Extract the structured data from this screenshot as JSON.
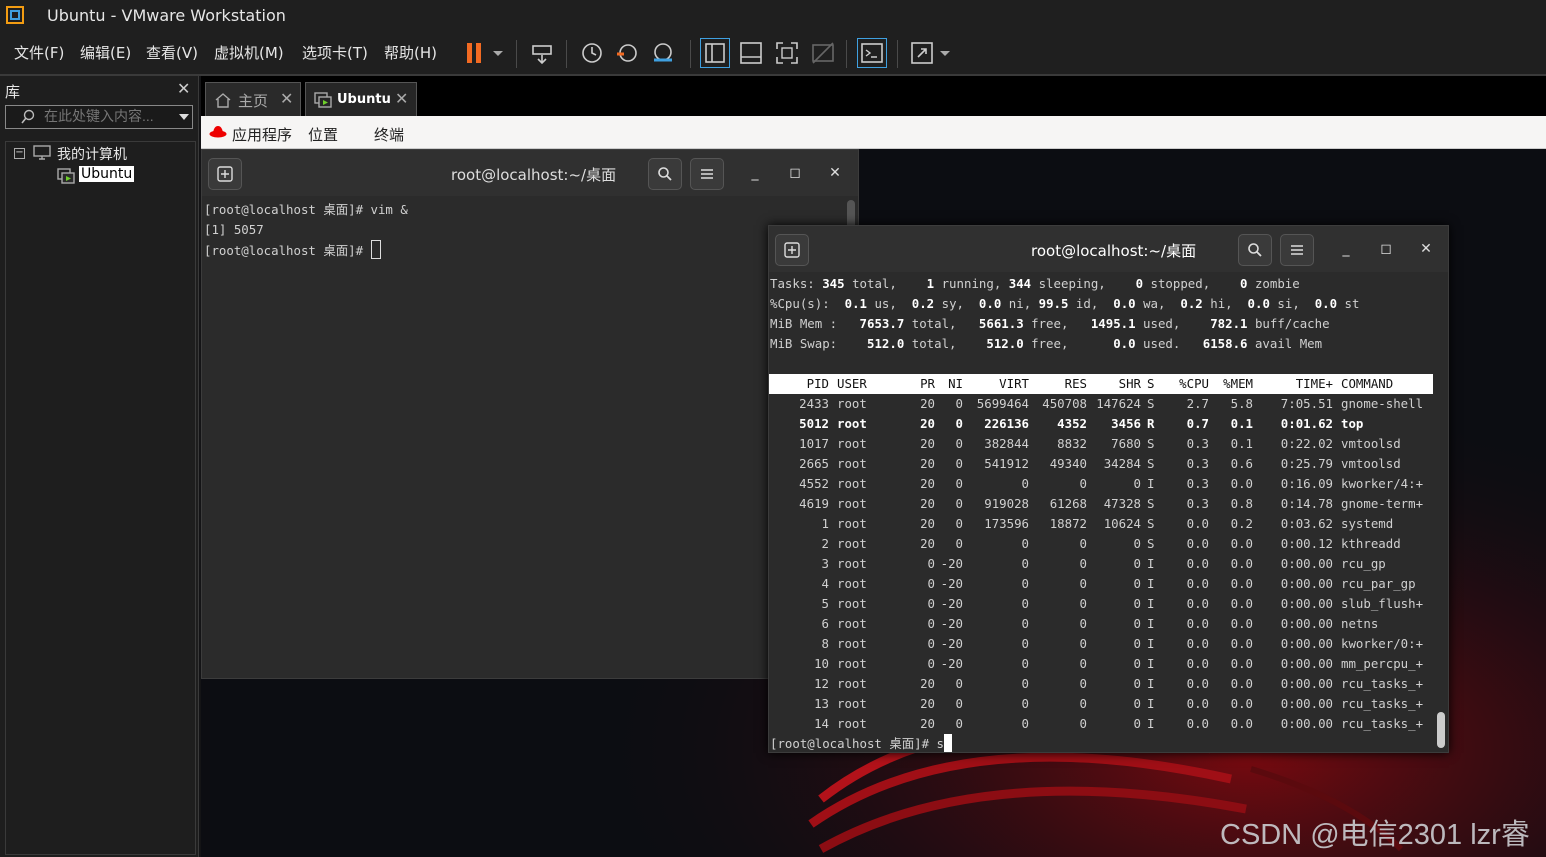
{
  "window": {
    "title": "Ubuntu - VMware Workstation"
  },
  "menu": [
    "文件(F)",
    "编辑(E)",
    "查看(V)",
    "虚拟机(M)",
    "选项卡(T)",
    "帮助(H)"
  ],
  "library": {
    "title": "库",
    "search_placeholder": "在此处键入内容...",
    "tree": {
      "root": "我的计算机",
      "child": "Ubuntu"
    }
  },
  "tabs": [
    {
      "label": "主页"
    },
    {
      "label": "Ubuntu"
    }
  ],
  "gnome": {
    "apps": "应用程序",
    "places": "位置",
    "terminal": "终端"
  },
  "term1": {
    "title": "root@localhost:~/桌面",
    "lines": [
      "[root@localhost 桌面]# vim &",
      "[1] 5057",
      "[root@localhost 桌面]# "
    ]
  },
  "term2": {
    "title": "root@localhost:~/桌面",
    "summary": {
      "tasks": {
        "total": "345",
        "running": "1",
        "sleeping": "344",
        "stopped": "0",
        "zombie": "0"
      },
      "cpu": {
        "us": "0.1",
        "sy": "0.2",
        "ni": "0.0",
        "id": "99.5",
        "wa": "0.0",
        "hi": "0.2",
        "si": "0.0",
        "st": "0.0"
      },
      "mem": {
        "total": "7653.7",
        "free": "5661.3",
        "used": "1495.1",
        "buff_cache": "782.1"
      },
      "swap": {
        "total": "512.0",
        "free": "512.0",
        "used": "0.0",
        "avail": "6158.6"
      }
    },
    "columns": [
      "PID",
      "USER",
      "PR",
      "NI",
      "VIRT",
      "RES",
      "SHR",
      "S",
      "%CPU",
      "%MEM",
      "TIME+",
      "COMMAND"
    ],
    "rows": [
      [
        "2433",
        "root",
        "20",
        "0",
        "5699464",
        "450708",
        "147624",
        "S",
        "2.7",
        "5.8",
        "7:05.51",
        "gnome-shell"
      ],
      [
        "5012",
        "root",
        "20",
        "0",
        "226136",
        "4352",
        "3456",
        "R",
        "0.7",
        "0.1",
        "0:01.62",
        "top"
      ],
      [
        "1017",
        "root",
        "20",
        "0",
        "382844",
        "8832",
        "7680",
        "S",
        "0.3",
        "0.1",
        "0:22.02",
        "vmtoolsd"
      ],
      [
        "2665",
        "root",
        "20",
        "0",
        "541912",
        "49340",
        "34284",
        "S",
        "0.3",
        "0.6",
        "0:25.79",
        "vmtoolsd"
      ],
      [
        "4552",
        "root",
        "20",
        "0",
        "0",
        "0",
        "0",
        "I",
        "0.3",
        "0.0",
        "0:16.09",
        "kworker/4:+"
      ],
      [
        "4619",
        "root",
        "20",
        "0",
        "919028",
        "61268",
        "47328",
        "S",
        "0.3",
        "0.8",
        "0:14.78",
        "gnome-term+"
      ],
      [
        "1",
        "root",
        "20",
        "0",
        "173596",
        "18872",
        "10624",
        "S",
        "0.0",
        "0.2",
        "0:03.62",
        "systemd"
      ],
      [
        "2",
        "root",
        "20",
        "0",
        "0",
        "0",
        "0",
        "S",
        "0.0",
        "0.0",
        "0:00.12",
        "kthreadd"
      ],
      [
        "3",
        "root",
        "0",
        "-20",
        "0",
        "0",
        "0",
        "I",
        "0.0",
        "0.0",
        "0:00.00",
        "rcu_gp"
      ],
      [
        "4",
        "root",
        "0",
        "-20",
        "0",
        "0",
        "0",
        "I",
        "0.0",
        "0.0",
        "0:00.00",
        "rcu_par_gp"
      ],
      [
        "5",
        "root",
        "0",
        "-20",
        "0",
        "0",
        "0",
        "I",
        "0.0",
        "0.0",
        "0:00.00",
        "slub_flush+"
      ],
      [
        "6",
        "root",
        "0",
        "-20",
        "0",
        "0",
        "0",
        "I",
        "0.0",
        "0.0",
        "0:00.00",
        "netns"
      ],
      [
        "8",
        "root",
        "0",
        "-20",
        "0",
        "0",
        "0",
        "I",
        "0.0",
        "0.0",
        "0:00.00",
        "kworker/0:+"
      ],
      [
        "10",
        "root",
        "0",
        "-20",
        "0",
        "0",
        "0",
        "I",
        "0.0",
        "0.0",
        "0:00.00",
        "mm_percpu_+"
      ],
      [
        "12",
        "root",
        "20",
        "0",
        "0",
        "0",
        "0",
        "I",
        "0.0",
        "0.0",
        "0:00.00",
        "rcu_tasks_+"
      ],
      [
        "13",
        "root",
        "20",
        "0",
        "0",
        "0",
        "0",
        "I",
        "0.0",
        "0.0",
        "0:00.00",
        "rcu_tasks_+"
      ],
      [
        "14",
        "root",
        "20",
        "0",
        "0",
        "0",
        "0",
        "I",
        "0.0",
        "0.0",
        "0:00.00",
        "rcu_tasks_+"
      ]
    ],
    "prompt": "[root@localhost 桌面]# s"
  },
  "watermark": "CSDN @电信2301  lzr睿"
}
